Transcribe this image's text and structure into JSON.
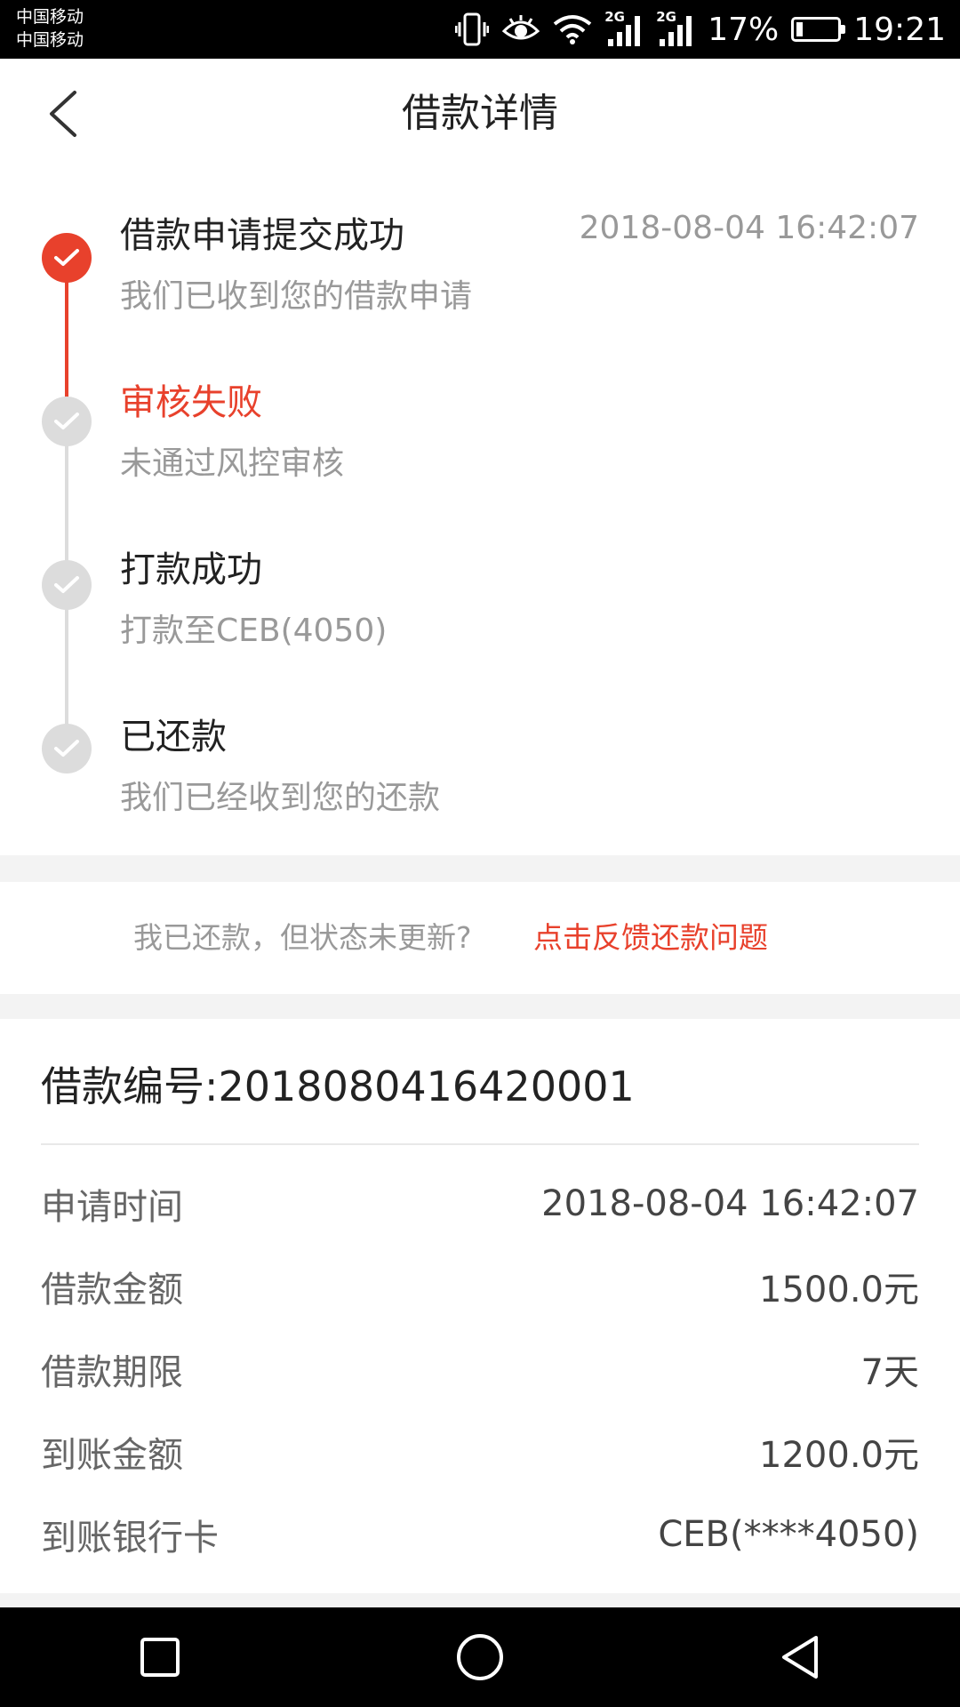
{
  "status_bar": {
    "carrier1": "中国移动",
    "carrier2": "中国移动",
    "net1": "2G",
    "net2": "2G",
    "battery_percent": "17%",
    "battery_level": 0.17,
    "time": "19:21",
    "icons": [
      "vibrate-icon",
      "eye-icon",
      "wifi-icon",
      "signal-icon",
      "signal-icon",
      "battery-icon"
    ]
  },
  "header": {
    "title": "借款详情",
    "back_icon": "chevron-left-icon"
  },
  "timeline": {
    "steps": [
      {
        "title": "借款申请提交成功",
        "subtitle": "我们已收到您的借款申请",
        "time": "2018-08-04 16:42:07",
        "state": "done"
      },
      {
        "title": "审核失败",
        "subtitle": "未通过风控审核",
        "time": "",
        "state": "failed"
      },
      {
        "title": "打款成功",
        "subtitle": "打款至CEB(4050)",
        "time": "",
        "state": "pending"
      },
      {
        "title": "已还款",
        "subtitle": "我们已经收到您的还款",
        "time": "",
        "state": "pending"
      }
    ]
  },
  "feedback": {
    "question": "我已还款，但状态未更新?",
    "link": "点击反馈还款问题"
  },
  "details": {
    "loan_number": "借款编号:2018080416420001",
    "rows": [
      {
        "label": "申请时间",
        "value": "2018-08-04 16:42:07"
      },
      {
        "label": "借款金额",
        "value": "1500.0元"
      },
      {
        "label": "借款期限",
        "value": "7天"
      },
      {
        "label": "到账金额",
        "value": "1200.0元"
      },
      {
        "label": "到账银行卡",
        "value": "CEB(****4050)"
      }
    ]
  },
  "nav": {
    "icons": [
      "recent-apps-icon",
      "home-icon",
      "back-icon"
    ]
  },
  "colors": {
    "accent": "#e8412c",
    "inactive": "#dcdcdc",
    "muted_text": "#999999"
  }
}
